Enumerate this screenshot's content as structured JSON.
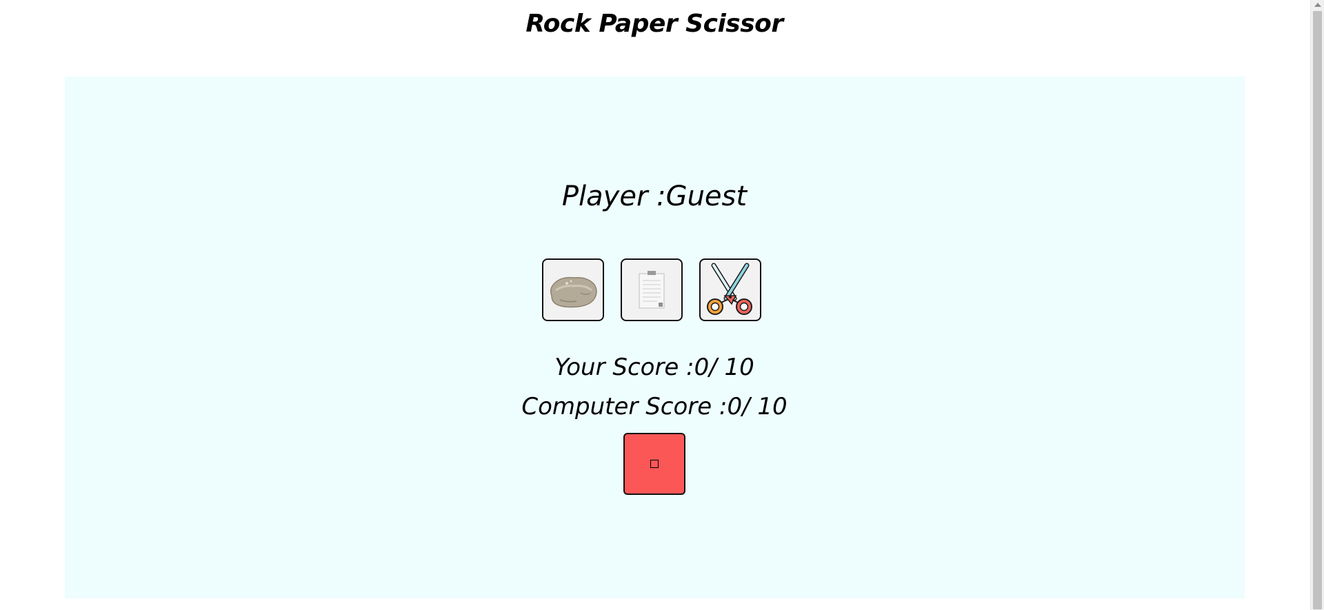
{
  "app": {
    "title": "Rock Paper Scissor"
  },
  "player": {
    "label": "Player :Guest"
  },
  "choices": [
    {
      "name": "rock",
      "icon": "rock-icon"
    },
    {
      "name": "paper",
      "icon": "paper-icon"
    },
    {
      "name": "scissors",
      "icon": "scissors-icon"
    }
  ],
  "scores": {
    "you": "Your Score :0/ 10",
    "computer": "Computer Score :0/ 10"
  },
  "reset": {
    "icon": "square-icon",
    "color": "#fc5757"
  },
  "colors": {
    "panel_bg": "#eefdfd",
    "button_bg": "#f2f2f2",
    "reset_bg": "#fc5757"
  }
}
